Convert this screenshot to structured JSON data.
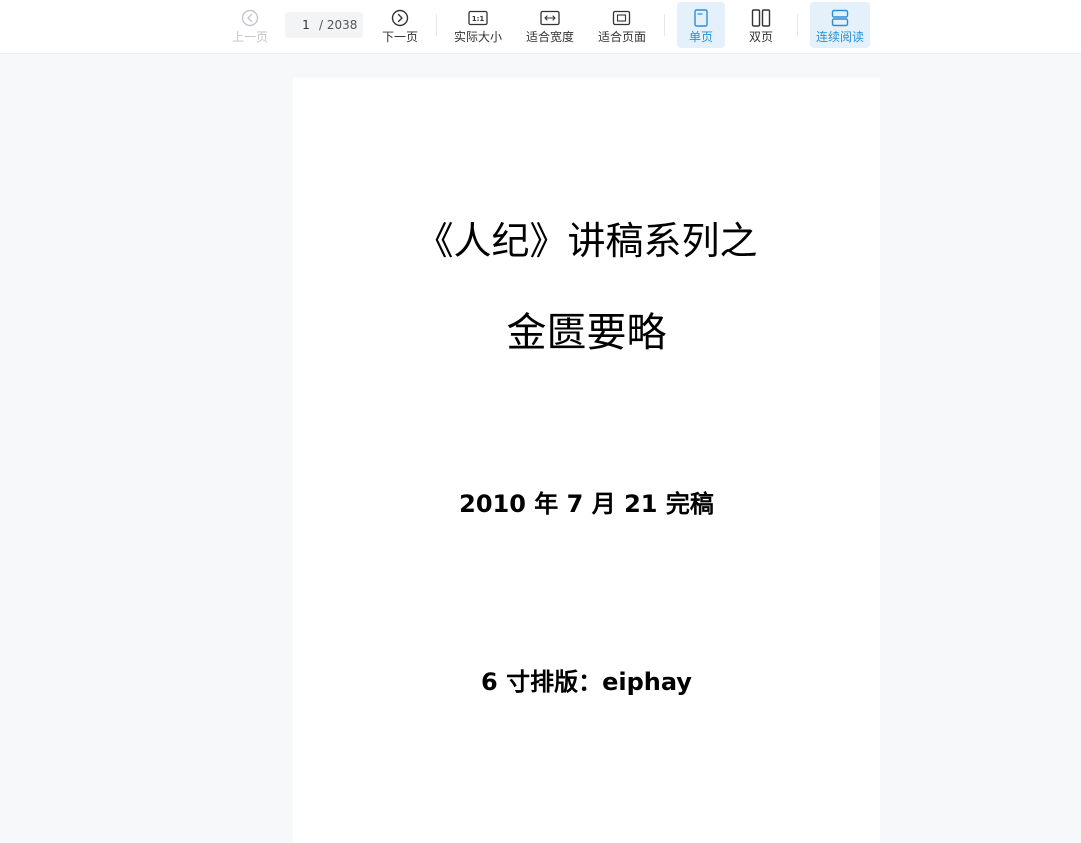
{
  "toolbar": {
    "prev_label": "上一页",
    "next_label": "下一页",
    "page_current": "1",
    "page_total": "/ 2038",
    "actual_size_label": "实际大小",
    "actual_size_glyph": "1:1",
    "fit_width_label": "适合宽度",
    "fit_page_label": "适合页面",
    "single_page_label": "单页",
    "double_page_label": "双页",
    "continuous_label": "连续阅读",
    "accent_color": "#2a8fd6",
    "active_bg": "#e4f1fb"
  },
  "document": {
    "title_line1": "《人纪》讲稿系列之",
    "title_line2": "金匮要略",
    "date_line": "2010 年 7 月 21 完稿",
    "layout_line": "6 寸排版：eiphay"
  }
}
